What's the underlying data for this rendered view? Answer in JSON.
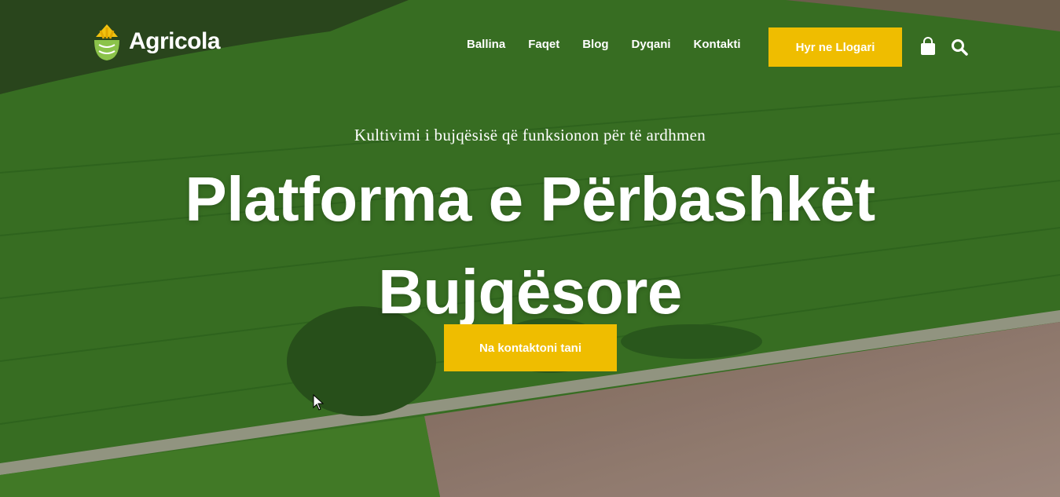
{
  "brand": {
    "name": "Agricola",
    "accent": "#efbd00",
    "logo_green": "#8bc34a"
  },
  "nav": {
    "items": [
      "Ballina",
      "Faqet",
      "Blog",
      "Dyqani",
      "Kontakti"
    ]
  },
  "header": {
    "login_label": "Hyr ne Llogari",
    "bag_icon": "shopping-bag-icon",
    "search_icon": "search-icon"
  },
  "hero": {
    "tagline": "Kultivimi i bujqësisë që funksionon për të ardhmen",
    "title_line1": "Platforma e Përbashkët",
    "title_line2": "Bujqësore",
    "cta_label": "Na kontaktoni tani"
  }
}
